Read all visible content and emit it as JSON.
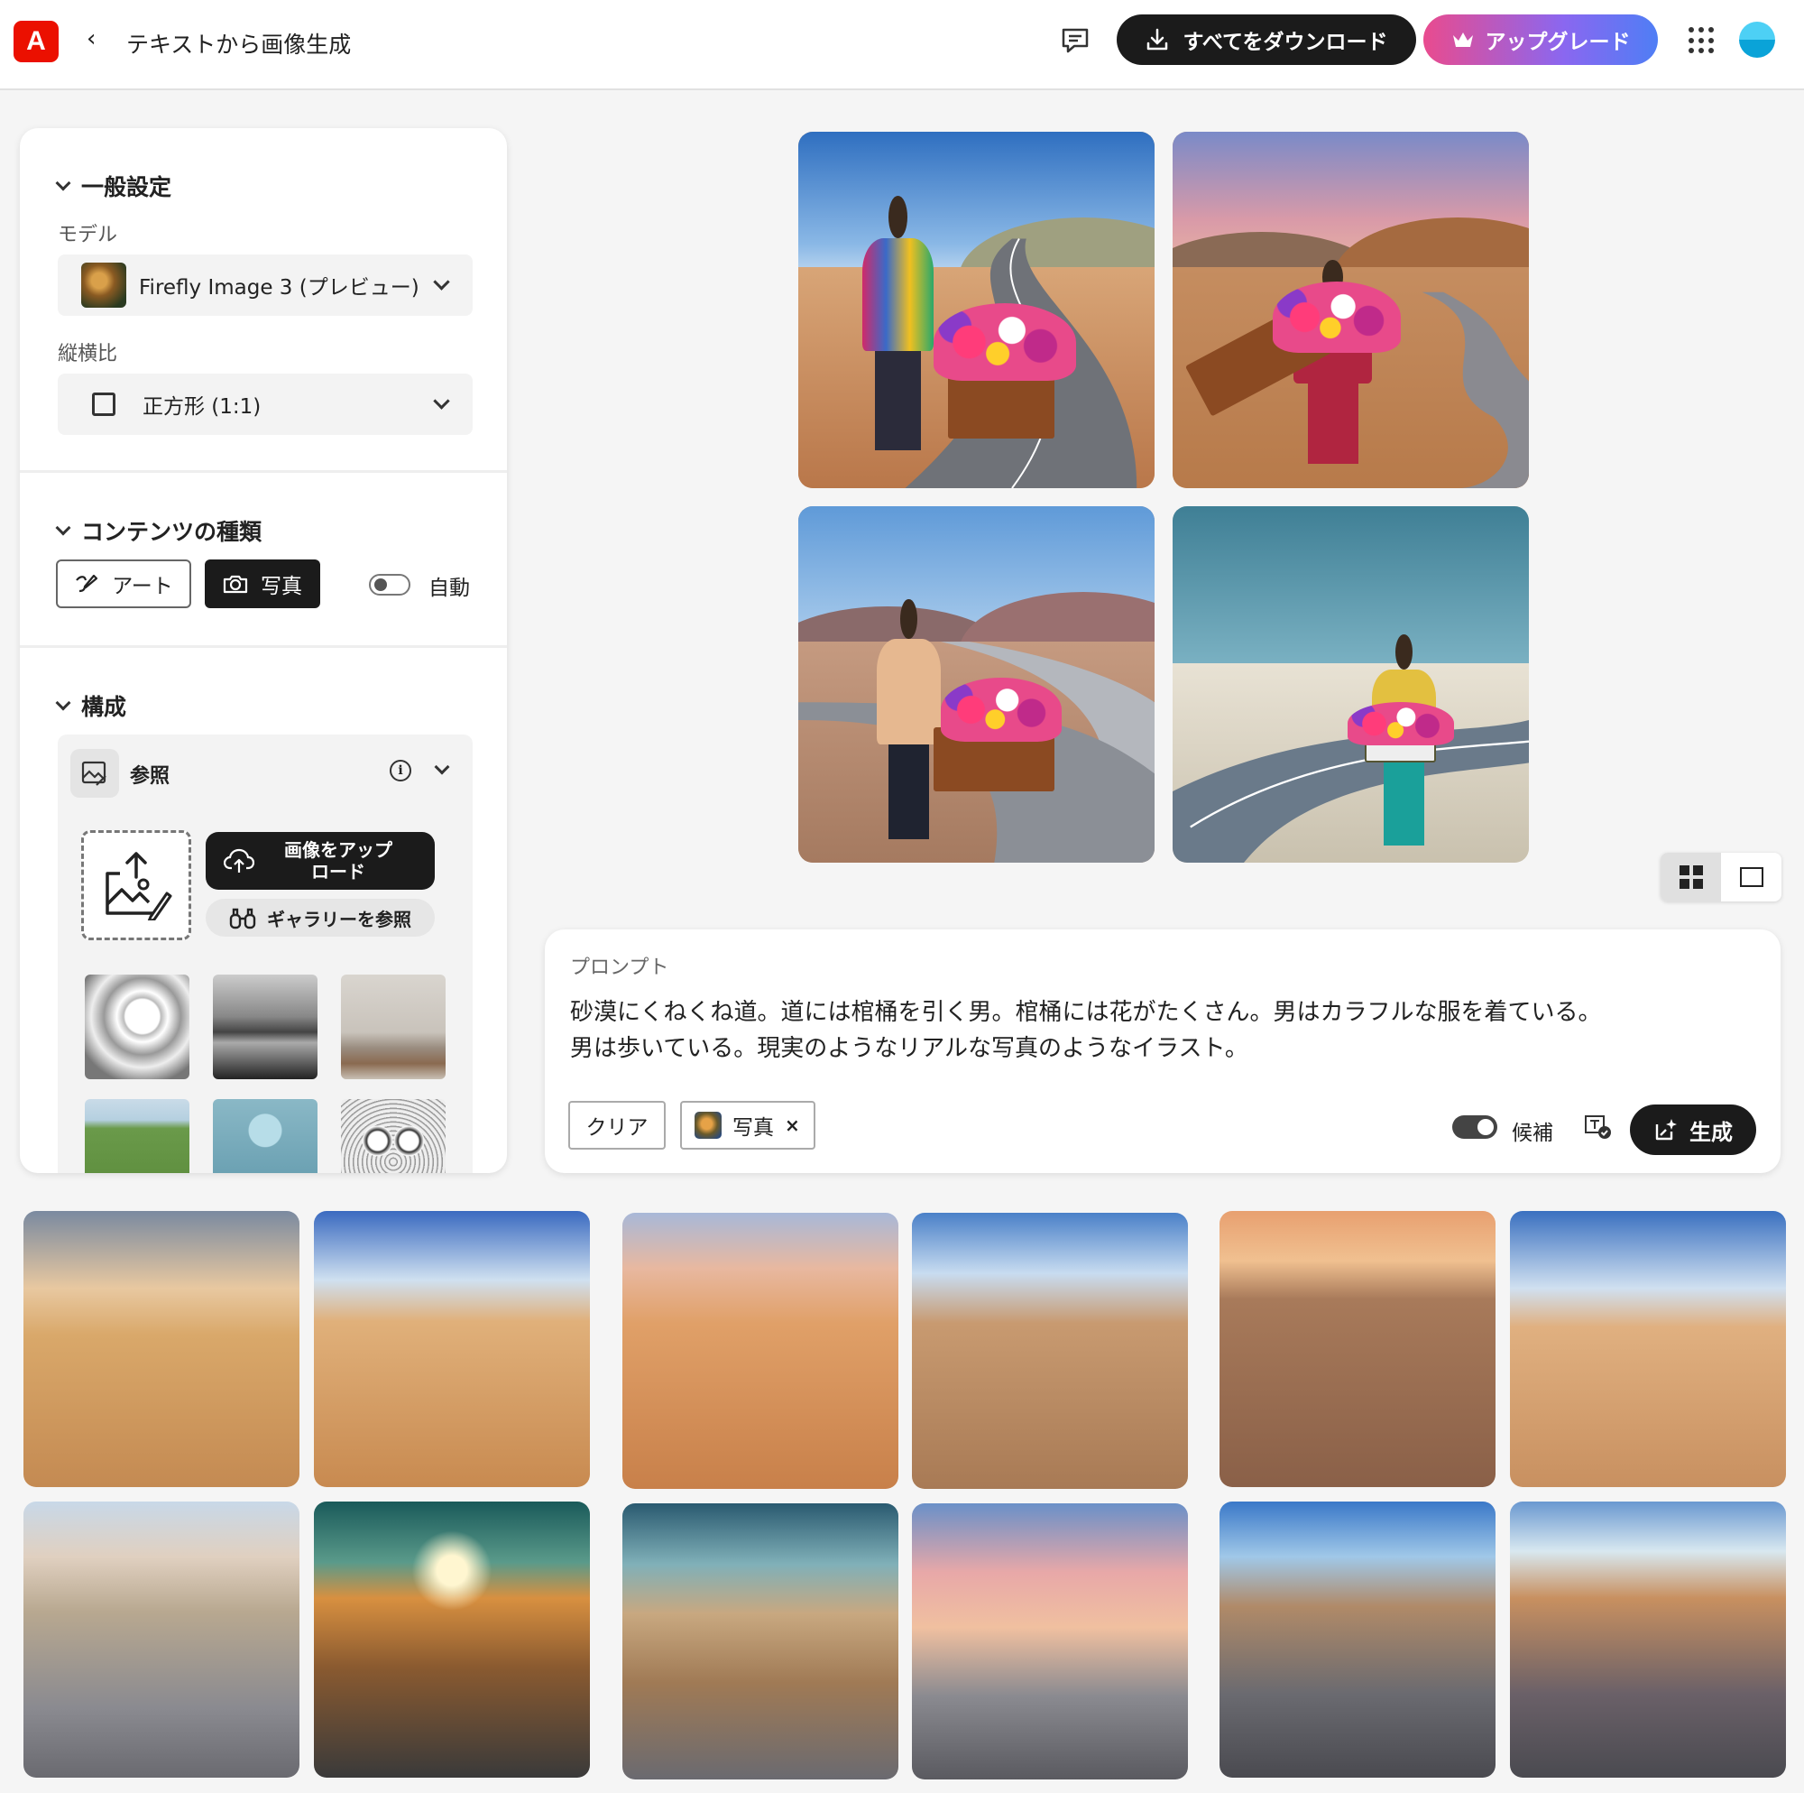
{
  "header": {
    "logo_text": "A",
    "back_label": "‹",
    "title": "テキストから画像生成",
    "download_label": "すべてをダウンロード",
    "upgrade_label": "アップグレード"
  },
  "left_panel": {
    "general": {
      "title": "一般設定",
      "model_label": "モデル",
      "model_value": "Firefly Image 3 (プレビュー)",
      "aspect_label": "縦横比",
      "aspect_value": "正方形 (1:1)"
    },
    "content_type": {
      "title": "コンテンツの種類",
      "art_label": "アート",
      "photo_label": "写真",
      "auto_label": "自動",
      "selected": "写真"
    },
    "composition": {
      "title": "構成",
      "reference_label": "参照",
      "upload_label": "画像をアップロード",
      "upload_line1": "画像をアップ",
      "upload_line2": "ロード",
      "gallery_label": "ギャラリーを参照"
    }
  },
  "prompt": {
    "label": "プロンプト",
    "text_line1": "砂漠にくねくね道。道には棺桶を引く男。棺桶には花がたくさん。男はカラフルな服を着ている。",
    "text_line2": "男は歩いている。現実のようなリアルな写真のようなイラスト。",
    "clear_label": "クリア",
    "chip_label": "写真",
    "chip_close": "×",
    "candidates_label": "候補",
    "generate_label": "生成"
  },
  "colors": {
    "accent_dark": "#1b1b1b",
    "adobe_red": "#eb1000",
    "upgrade_gradient_start": "#e94b8e",
    "upgrade_gradient_end": "#4f7ef5"
  }
}
